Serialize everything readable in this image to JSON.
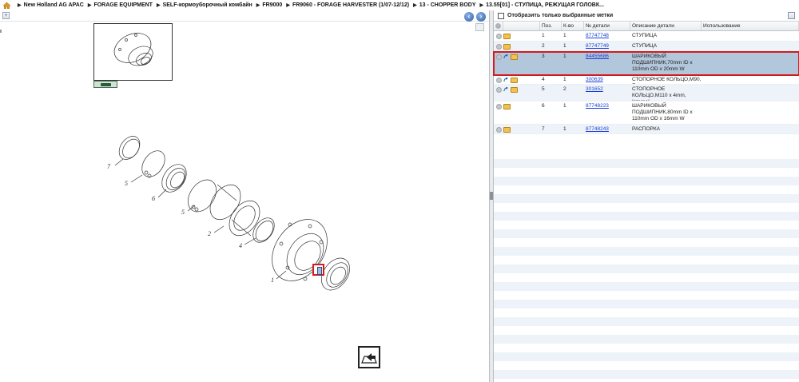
{
  "breadcrumb": [
    "New Holland AG APAC",
    "FORAGE EQUIPMENT",
    "SELF-кормоуборочный комбайн",
    "FR9000",
    "FR9060 - FORAGE HARVESTER (1/07-12/12)",
    "13 - CHOPPER BODY",
    "13.55[01] - СТУПИЦА, РЕЖУЩАЯ ГОЛОВК..."
  ],
  "filter": {
    "label": "Отобразить только выбранные метки"
  },
  "table": {
    "headers": {
      "pos": "Поз.",
      "qty": "К-во",
      "part_no": "№ детали",
      "desc": "Описание детали",
      "usage": "Использование"
    },
    "rows": [
      {
        "pos": "1",
        "qty": "1",
        "part_no": "87747748",
        "desc": "СТУПИЦА",
        "usage": ""
      },
      {
        "pos": "2",
        "qty": "1",
        "part_no": "87747749",
        "desc": "СТУПИЦА",
        "usage": ""
      },
      {
        "pos": "3",
        "qty": "1",
        "part_no": "84455686",
        "desc": "ШАРИКОВЫЙ ПОДШИПНИК,70mm ID x 110mm OD x 20mm W",
        "usage": ""
      },
      {
        "pos": "4",
        "qty": "1",
        "part_no": "300639",
        "desc": "СТОПОРНОЕ КОЛЬЦО,M90, Ext",
        "usage": ""
      },
      {
        "pos": "5",
        "qty": "2",
        "part_no": "301652",
        "desc": "СТОПОРНОЕ КОЛЬЦО,M110 x 4mm, Internal",
        "usage": ""
      },
      {
        "pos": "6",
        "qty": "1",
        "part_no": "87748223",
        "desc": "ШАРИКОВЫЙ ПОДШИПНИК,80mm ID x 110mm OD x 16mm W",
        "usage": ""
      },
      {
        "pos": "7",
        "qty": "1",
        "part_no": "87748243",
        "desc": "РАСПОРКА",
        "usage": ""
      }
    ]
  },
  "diagram": {
    "callouts": [
      "7",
      "5",
      "6",
      "5",
      "2",
      "4",
      "1"
    ]
  },
  "colors": {
    "selected_row": "#b3c7dc",
    "highlight": "#d21c1c",
    "link": "#1a3fd6"
  },
  "icons": [
    "home-icon",
    "expand-icon",
    "prev-icon",
    "next-icon",
    "export-icon",
    "part-box-icon",
    "link-arrow-icon"
  ]
}
